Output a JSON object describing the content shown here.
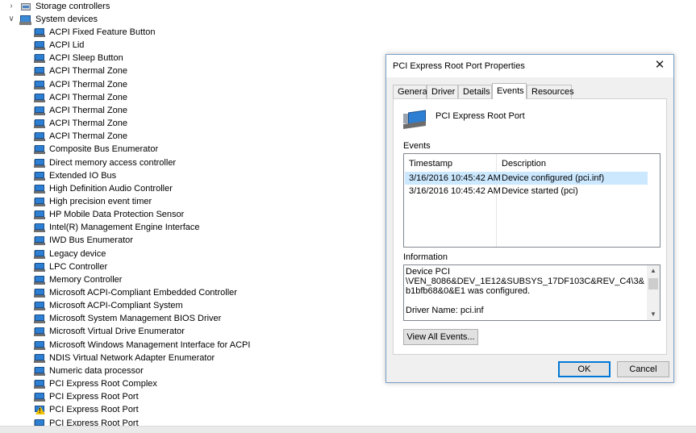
{
  "device_manager": {
    "categories": [
      {
        "label": "Storage controllers",
        "expanded": false,
        "icon": "storage-controller-icon"
      },
      {
        "label": "System devices",
        "expanded": true,
        "icon": "system-devices-icon"
      }
    ],
    "system_devices": [
      {
        "label": "ACPI Fixed Feature Button",
        "icon": "system-device-icon"
      },
      {
        "label": "ACPI Lid",
        "icon": "system-device-icon"
      },
      {
        "label": "ACPI Sleep Button",
        "icon": "system-device-icon"
      },
      {
        "label": "ACPI Thermal Zone",
        "icon": "system-device-icon"
      },
      {
        "label": "ACPI Thermal Zone",
        "icon": "system-device-icon"
      },
      {
        "label": "ACPI Thermal Zone",
        "icon": "system-device-icon"
      },
      {
        "label": "ACPI Thermal Zone",
        "icon": "system-device-icon"
      },
      {
        "label": "ACPI Thermal Zone",
        "icon": "system-device-icon"
      },
      {
        "label": "ACPI Thermal Zone",
        "icon": "system-device-icon"
      },
      {
        "label": "Composite Bus Enumerator",
        "icon": "system-device-icon"
      },
      {
        "label": "Direct memory access controller",
        "icon": "system-device-icon"
      },
      {
        "label": "Extended IO Bus",
        "icon": "system-device-icon"
      },
      {
        "label": "High Definition Audio Controller",
        "icon": "system-device-icon"
      },
      {
        "label": "High precision event timer",
        "icon": "system-device-icon"
      },
      {
        "label": "HP Mobile Data Protection Sensor",
        "icon": "system-device-icon"
      },
      {
        "label": "Intel(R) Management Engine Interface",
        "icon": "system-device-icon"
      },
      {
        "label": "IWD Bus Enumerator",
        "icon": "system-device-icon"
      },
      {
        "label": "Legacy device",
        "icon": "system-device-icon"
      },
      {
        "label": "LPC Controller",
        "icon": "system-device-icon"
      },
      {
        "label": "Memory Controller",
        "icon": "system-device-icon"
      },
      {
        "label": "Microsoft ACPI-Compliant Embedded Controller",
        "icon": "system-device-icon"
      },
      {
        "label": "Microsoft ACPI-Compliant System",
        "icon": "system-device-icon"
      },
      {
        "label": "Microsoft System Management BIOS Driver",
        "icon": "system-device-icon"
      },
      {
        "label": "Microsoft Virtual Drive Enumerator",
        "icon": "system-device-icon"
      },
      {
        "label": "Microsoft Windows Management Interface for ACPI",
        "icon": "system-device-icon"
      },
      {
        "label": "NDIS Virtual Network Adapter Enumerator",
        "icon": "system-device-icon"
      },
      {
        "label": "Numeric data processor",
        "icon": "system-device-icon"
      },
      {
        "label": "PCI Express Root Complex",
        "icon": "system-device-icon"
      },
      {
        "label": "PCI Express Root Port",
        "icon": "system-device-icon"
      },
      {
        "label": "PCI Express Root Port",
        "icon": "warning-device-icon"
      },
      {
        "label": "PCI Express Root Port",
        "icon": "system-device-icon"
      }
    ]
  },
  "dialog": {
    "title": "PCI Express Root Port Properties",
    "close_glyph": "✕",
    "tabs": [
      "General",
      "Driver",
      "Details",
      "Events",
      "Resources"
    ],
    "active_tab": "Events",
    "device_name": "PCI Express Root Port",
    "events_label": "Events",
    "columns": {
      "timestamp": "Timestamp",
      "description": "Description"
    },
    "events": [
      {
        "timestamp": "3/16/2016 10:45:42 AM",
        "description": "Device configured (pci.inf)",
        "selected": true
      },
      {
        "timestamp": "3/16/2016 10:45:42 AM",
        "description": "Device started (pci)",
        "selected": false
      }
    ],
    "information_label": "Information",
    "information_text": "Device PCI\n\\VEN_8086&DEV_1E12&SUBSYS_17DF103C&REV_C4\\3&b1bfb68&0&E1 was configured.\n\nDriver Name: pci.inf",
    "view_all_label": "View All Events...",
    "ok_label": "OK",
    "cancel_label": "Cancel",
    "accent_color": "#0078d7",
    "selection_color": "#cce8ff"
  }
}
